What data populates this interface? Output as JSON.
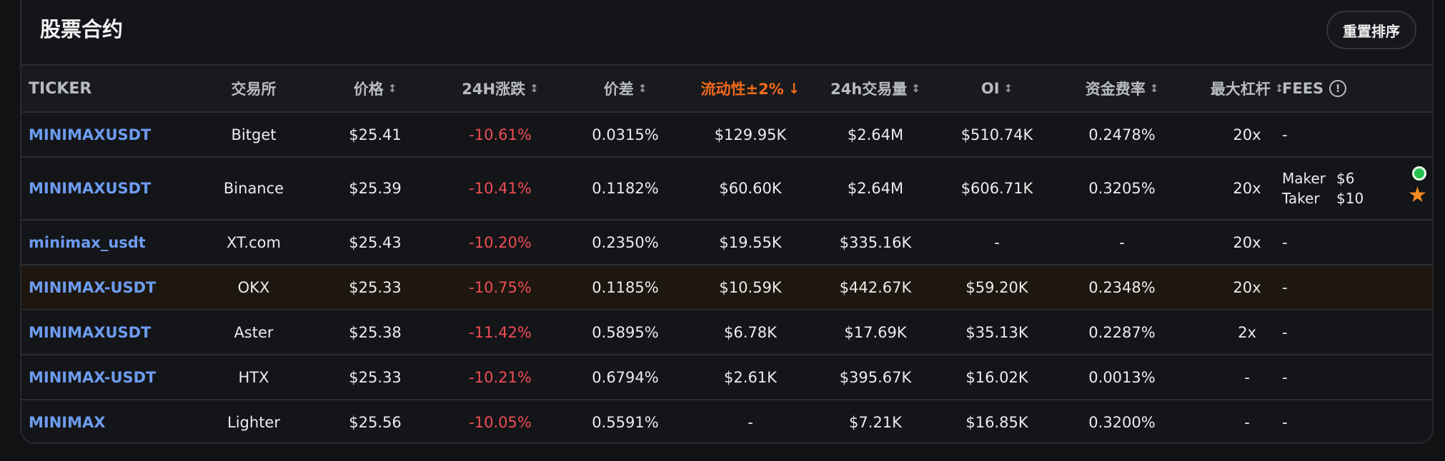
{
  "panel": {
    "title": "股票合约",
    "reset_label": "重置排序"
  },
  "columns": [
    {
      "key": "ticker",
      "label": "TICKER",
      "sort": ""
    },
    {
      "key": "exchange",
      "label": "交易所",
      "sort": ""
    },
    {
      "key": "price",
      "label": "价格",
      "sort": "↕"
    },
    {
      "key": "change",
      "label": "24H涨跌",
      "sort": "↕"
    },
    {
      "key": "spread",
      "label": "价差",
      "sort": "↕"
    },
    {
      "key": "liq",
      "label": "流动性±2%",
      "sort": "↓"
    },
    {
      "key": "vol",
      "label": "24h交易量",
      "sort": "↕"
    },
    {
      "key": "oi",
      "label": "OI",
      "sort": "↕"
    },
    {
      "key": "fund",
      "label": "资金费率",
      "sort": "↕"
    },
    {
      "key": "lev",
      "label": "最大杠杆",
      "sort": "↕"
    },
    {
      "key": "fees",
      "label": "FEES",
      "sort": "",
      "icon": "info-icon",
      "icon_glyph": "!"
    }
  ],
  "rows": [
    {
      "ticker": "MINIMAXUSDT",
      "exchange": "Bitget",
      "price": "$25.41",
      "change": "-10.61%",
      "spread": "0.0315%",
      "liq": "$129.95K",
      "vol": "$2.64M",
      "oi": "$510.74K",
      "fund": "0.2478%",
      "lev": "20x",
      "fees": "-"
    },
    {
      "ticker": "MINIMAXUSDT",
      "exchange": "Binance",
      "price": "$25.39",
      "change": "-10.41%",
      "spread": "0.1182%",
      "liq": "$60.60K",
      "vol": "$2.64M",
      "oi": "$606.71K",
      "fund": "0.3205%",
      "lev": "20x",
      "fees_detail": {
        "maker_label": "Maker",
        "maker_value": "$6",
        "taker_label": "Taker",
        "taker_value": "$10"
      },
      "status_icon": "online-status-icon",
      "star_icon": "star-icon",
      "star_glyph": "★"
    },
    {
      "ticker": "minimax_usdt",
      "exchange": "XT.com",
      "price": "$25.43",
      "change": "-10.20%",
      "spread": "0.2350%",
      "liq": "$19.55K",
      "vol": "$335.16K",
      "oi": "-",
      "fund": "-",
      "lev": "20x",
      "fees": "-"
    },
    {
      "ticker": "MINIMAX-USDT",
      "exchange": "OKX",
      "price": "$25.33",
      "change": "-10.75%",
      "spread": "0.1185%",
      "liq": "$10.59K",
      "vol": "$442.67K",
      "oi": "$59.20K",
      "fund": "0.2348%",
      "lev": "20x",
      "fees": "-"
    },
    {
      "ticker": "MINIMAXUSDT",
      "exchange": "Aster",
      "price": "$25.38",
      "change": "-11.42%",
      "spread": "0.5895%",
      "liq": "$6.78K",
      "vol": "$17.69K",
      "oi": "$35.13K",
      "fund": "0.2287%",
      "lev": "2x",
      "fees": "-"
    },
    {
      "ticker": "MINIMAX-USDT",
      "exchange": "HTX",
      "price": "$25.33",
      "change": "-10.21%",
      "spread": "0.6794%",
      "liq": "$2.61K",
      "vol": "$395.67K",
      "oi": "$16.02K",
      "fund": "0.0013%",
      "lev": "-",
      "fees": "-"
    },
    {
      "ticker": "MINIMAX",
      "exchange": "Lighter",
      "price": "$25.56",
      "change": "-10.05%",
      "spread": "0.5591%",
      "liq": "-",
      "vol": "$7.21K",
      "oi": "$16.85K",
      "fund": "0.3200%",
      "lev": "-",
      "fees": "-"
    }
  ],
  "colors": {
    "ticker": "#6d9cf0",
    "negative": "#ef4d55",
    "active_sort": "#f26a1b",
    "highlight_row": "#1d1710",
    "status_online": "#23c24f",
    "star": "#f68a1f"
  }
}
